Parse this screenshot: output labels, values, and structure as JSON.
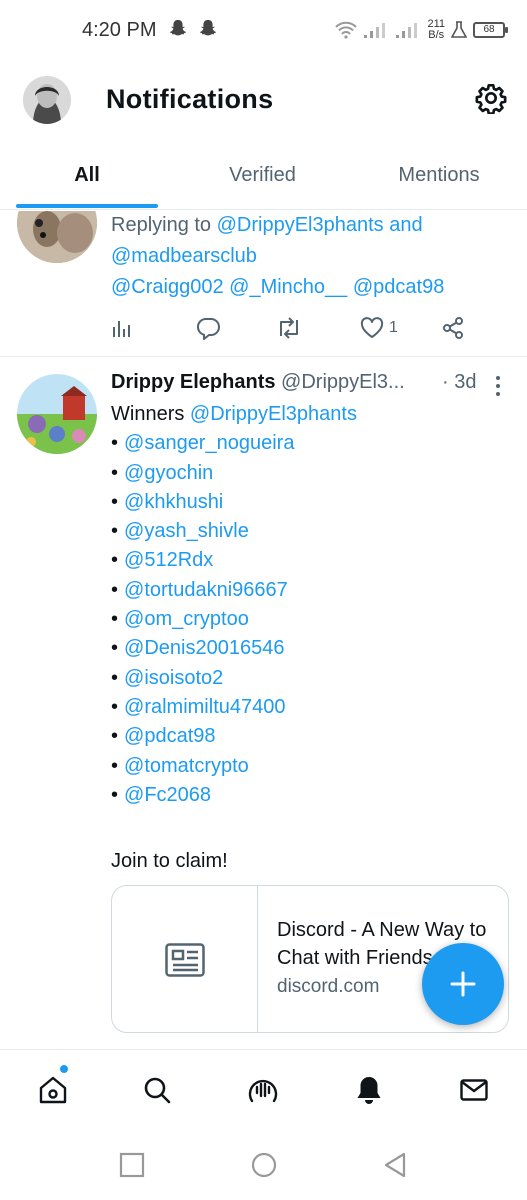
{
  "status_bar": {
    "time": "4:20 PM",
    "net_speed_value": "211",
    "net_speed_unit": "B/s",
    "battery": "68"
  },
  "header": {
    "title": "Notifications"
  },
  "tabs": [
    {
      "label": "All",
      "active": true
    },
    {
      "label": "Verified",
      "active": false
    },
    {
      "label": "Mentions",
      "active": false
    }
  ],
  "post1": {
    "replying_prefix": "Replying to ",
    "reply_handle_1": "@DrippyEl3phants",
    "reply_and": " and",
    "reply_handle_2": "@madbearsclub",
    "mentions": [
      "@Craigg002",
      "@_Mincho__",
      "@pdcat98"
    ],
    "like_count": "1"
  },
  "post2": {
    "display_name": "Drippy Elephants",
    "handle": "@DrippyEl3...",
    "time": "· 3d",
    "winners_prefix": "Winners ",
    "winners_handle": "@DrippyEl3phants",
    "winners": [
      "@sanger_nogueira",
      "@gyochin",
      "@khkhushi",
      "@yash_shivle",
      "@512Rdx",
      "@tortudakni96667",
      "@om_cryptoo",
      "@Denis20016546",
      "@isoisoto2",
      "@ralmimiltu47400",
      "@pdcat98",
      "@tomatcrypto",
      "@Fc2068"
    ],
    "join_text": "Join to claim!",
    "card": {
      "title": "Discord - A New Way to Chat with Friends",
      "domain": "discord.com"
    }
  },
  "colors": {
    "accent": "#1d9bf0",
    "secondary_text": "#536471",
    "divider": "#e6ecf0"
  },
  "icons": {
    "header": [
      "avatar",
      "gear-icon"
    ],
    "actions": [
      "analytics-icon",
      "reply-icon",
      "retweet-icon",
      "like-icon",
      "share-icon"
    ],
    "bottom_nav": [
      "home-icon",
      "search-icon",
      "spaces-icon",
      "bell-icon",
      "mail-icon"
    ],
    "fab": "plus-icon"
  }
}
